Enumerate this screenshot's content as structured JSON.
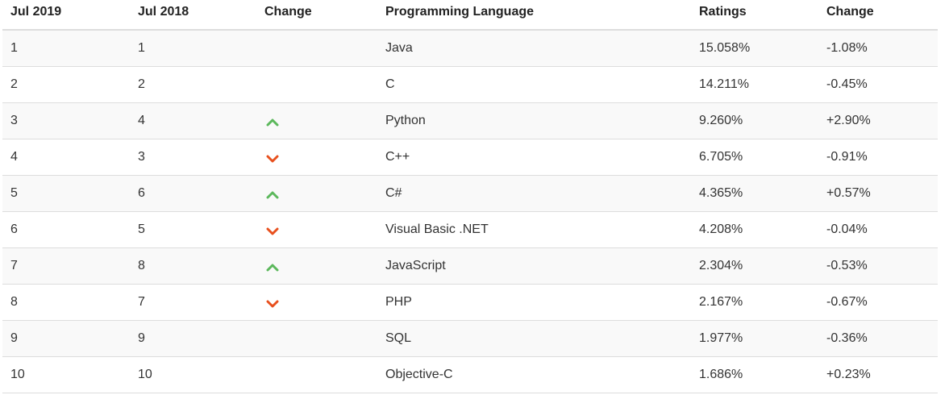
{
  "table": {
    "headers": [
      "Jul 2019",
      "Jul 2018",
      "Change",
      "Programming Language",
      "Ratings",
      "Change"
    ],
    "colors": {
      "up": "#5cb85c",
      "down": "#e8501e"
    },
    "rows": [
      {
        "rank_2019": "1",
        "rank_2018": "1",
        "trend": "none",
        "language": "Java",
        "rating": "15.058%",
        "change": "-1.08%"
      },
      {
        "rank_2019": "2",
        "rank_2018": "2",
        "trend": "none",
        "language": "C",
        "rating": "14.211%",
        "change": "-0.45%"
      },
      {
        "rank_2019": "3",
        "rank_2018": "4",
        "trend": "up",
        "language": "Python",
        "rating": "9.260%",
        "change": "+2.90%"
      },
      {
        "rank_2019": "4",
        "rank_2018": "3",
        "trend": "down",
        "language": "C++",
        "rating": "6.705%",
        "change": "-0.91%"
      },
      {
        "rank_2019": "5",
        "rank_2018": "6",
        "trend": "up",
        "language": "C#",
        "rating": "4.365%",
        "change": "+0.57%"
      },
      {
        "rank_2019": "6",
        "rank_2018": "5",
        "trend": "down",
        "language": "Visual Basic .NET",
        "rating": "4.208%",
        "change": "-0.04%"
      },
      {
        "rank_2019": "7",
        "rank_2018": "8",
        "trend": "up",
        "language": "JavaScript",
        "rating": "2.304%",
        "change": "-0.53%"
      },
      {
        "rank_2019": "8",
        "rank_2018": "7",
        "trend": "down",
        "language": "PHP",
        "rating": "2.167%",
        "change": "-0.67%"
      },
      {
        "rank_2019": "9",
        "rank_2018": "9",
        "trend": "none",
        "language": "SQL",
        "rating": "1.977%",
        "change": "-0.36%"
      },
      {
        "rank_2019": "10",
        "rank_2018": "10",
        "trend": "none",
        "language": "Objective-C",
        "rating": "1.686%",
        "change": "+0.23%"
      }
    ]
  }
}
